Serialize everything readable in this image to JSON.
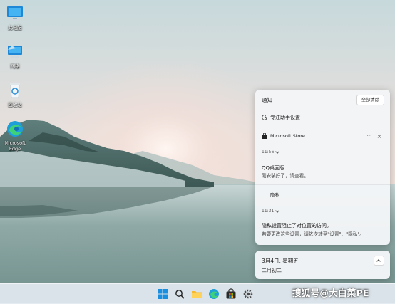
{
  "desktop": {
    "icons": [
      {
        "label": "此电脑",
        "icon": "computer-icon"
      },
      {
        "label": "网络",
        "icon": "network-icon"
      },
      {
        "label": "回收站",
        "icon": "recycle-bin-icon"
      },
      {
        "label": "Microsoft Edge",
        "icon": "edge-icon"
      }
    ]
  },
  "notifications": {
    "title": "通知",
    "clear_all": "全部清除",
    "focus_assist": "专注助手设置",
    "groups": [
      {
        "app": "Microsoft Store",
        "time": "11:56",
        "title": "QQ桌面版",
        "body": "刚安装好了，请查看。"
      },
      {
        "app": "隐私",
        "time": "11:31",
        "title": "隐私设置阻止了对位置的访问。",
        "body": "若要更改这些设置，请依次转至\"设置\"、\"隐私\"。"
      }
    ]
  },
  "calendar": {
    "date": "3月4日, 星期五",
    "lunar": "二月初二"
  },
  "taskbar": {
    "apps": [
      "start-icon",
      "search-icon",
      "file-explorer-icon",
      "edge-icon",
      "store-icon",
      "settings-icon"
    ]
  },
  "watermark": "搜狐号@大白菜PE"
}
